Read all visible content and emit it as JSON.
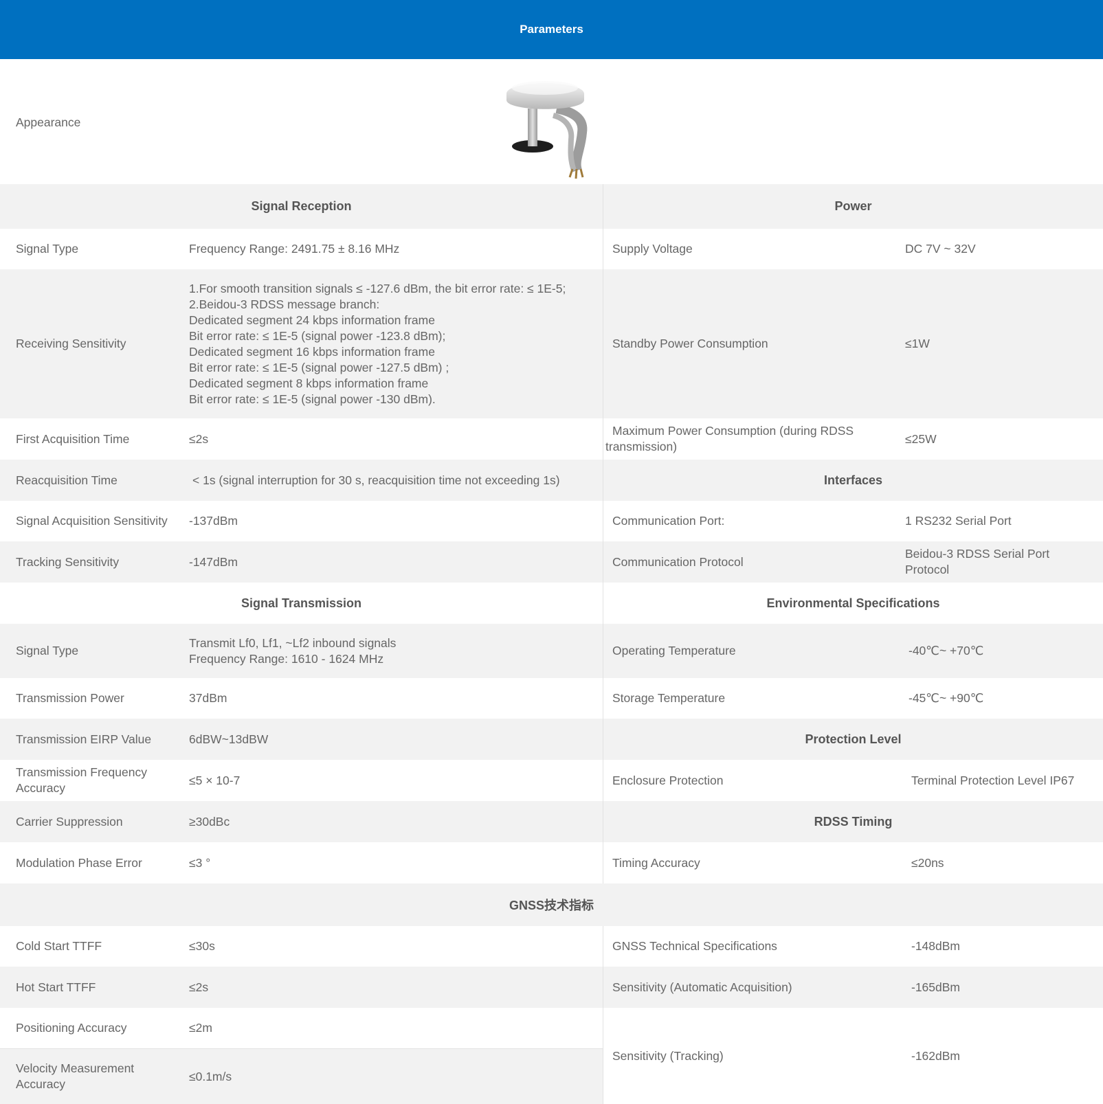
{
  "header": {
    "title": "Parameters"
  },
  "appearance": {
    "label": "Appearance"
  },
  "sections": {
    "signal_reception": "Signal Reception",
    "power": "Power",
    "interfaces": "Interfaces",
    "signal_transmission": "Signal Transmission",
    "environmental": "Environmental Specifications",
    "protection_level": "Protection Level",
    "rdss_timing": "RDSS Timing",
    "gnss": "GNSS技术指标"
  },
  "left": {
    "signal_type": {
      "label": "Signal Type",
      "value": "Frequency Range: 2491.75 ± 8.16 MHz"
    },
    "receiving_sensitivity": {
      "label": "Receiving Sensitivity",
      "lines": [
        "1.For smooth transition signals ≤ -127.6 dBm, the bit error rate: ≤ 1E-5;",
        "2.Beidou-3 RDSS message branch:",
        "Dedicated segment 24 kbps information frame",
        "Bit error rate: ≤ 1E-5 (signal power -123.8 dBm);",
        "Dedicated segment 16 kbps information frame",
        "Bit error rate: ≤ 1E-5 (signal power -127.5 dBm) ;",
        "Dedicated segment 8 kbps information frame",
        "Bit error rate: ≤ 1E-5 (signal power -130 dBm)."
      ]
    },
    "first_acquisition": {
      "label": "First Acquisition Time",
      "value": "≤2s"
    },
    "reacquisition": {
      "label": "Reacquisition Time",
      "value": "< 1s (signal interruption for 30 s, reacquisition time not exceeding 1s)"
    },
    "signal_acq_sens": {
      "label": "Signal Acquisition Sensitivity",
      "value": "-137dBm"
    },
    "tracking_sens": {
      "label": "Tracking Sensitivity",
      "value": "-147dBm"
    },
    "tx_signal_type": {
      "label": "Signal Type",
      "line1": "Transmit Lf0, Lf1, ~Lf2 inbound signals",
      "line2": "Frequency Range: 1610 - 1624 MHz"
    },
    "tx_power": {
      "label": "Transmission Power",
      "value": "37dBm"
    },
    "tx_eirp": {
      "label": "Transmission EIRP Value",
      "value": "6dBW~13dBW"
    },
    "tx_freq_acc": {
      "label_line1": "Transmission Frequency",
      "label_line2": "Accuracy",
      "value": "≤5 × 10-7"
    },
    "carrier_supp": {
      "label": "Carrier Suppression",
      "value": "≥30dBc"
    },
    "mod_phase_err": {
      "label": "Modulation Phase Error",
      "value": "≤3 °"
    },
    "cold_start": {
      "label": "Cold Start TTFF",
      "value": "≤30s"
    },
    "hot_start": {
      "label": "Hot Start TTFF",
      "value": "≤2s"
    },
    "pos_acc": {
      "label": "Positioning Accuracy",
      "value": "≤2m"
    },
    "vel_acc": {
      "label_line1": "Velocity Measurement",
      "label_line2": "Accuracy",
      "value": "≤0.1m/s"
    }
  },
  "right": {
    "supply_voltage": {
      "label": "Supply Voltage",
      "value": "DC 7V ~ 32V"
    },
    "standby_power": {
      "label": "Standby Power Consumption",
      "value": "≤1W"
    },
    "max_power": {
      "label_line1": "Maximum Power Consumption (during RDSS",
      "label_line2": "transmission)",
      "value": "≤25W"
    },
    "comm_port": {
      "label": "Communication Port:",
      "value": "1 RS232 Serial Port"
    },
    "comm_protocol": {
      "label": "Communication Protocol",
      "value_line1": "Beidou-3 RDSS Serial Port",
      "value_line2": "Protocol"
    },
    "op_temp": {
      "label": "Operating Temperature",
      "value": "-40℃~ +70℃"
    },
    "storage_temp": {
      "label": "Storage Temperature",
      "value": "-45℃~ +90℃"
    },
    "enclosure": {
      "label": "Enclosure Protection",
      "value": "Terminal Protection Level IP67"
    },
    "timing_acc": {
      "label": "Timing Accuracy",
      "value": "≤20ns"
    },
    "gnss_tech": {
      "label": "GNSS Technical Specifications",
      "value": "-148dBm"
    },
    "sens_auto": {
      "label": "Sensitivity (Automatic Acquisition)",
      "value": "-165dBm"
    },
    "sens_track": {
      "label": "Sensitivity (Tracking)",
      "value": "-162dBm"
    }
  }
}
